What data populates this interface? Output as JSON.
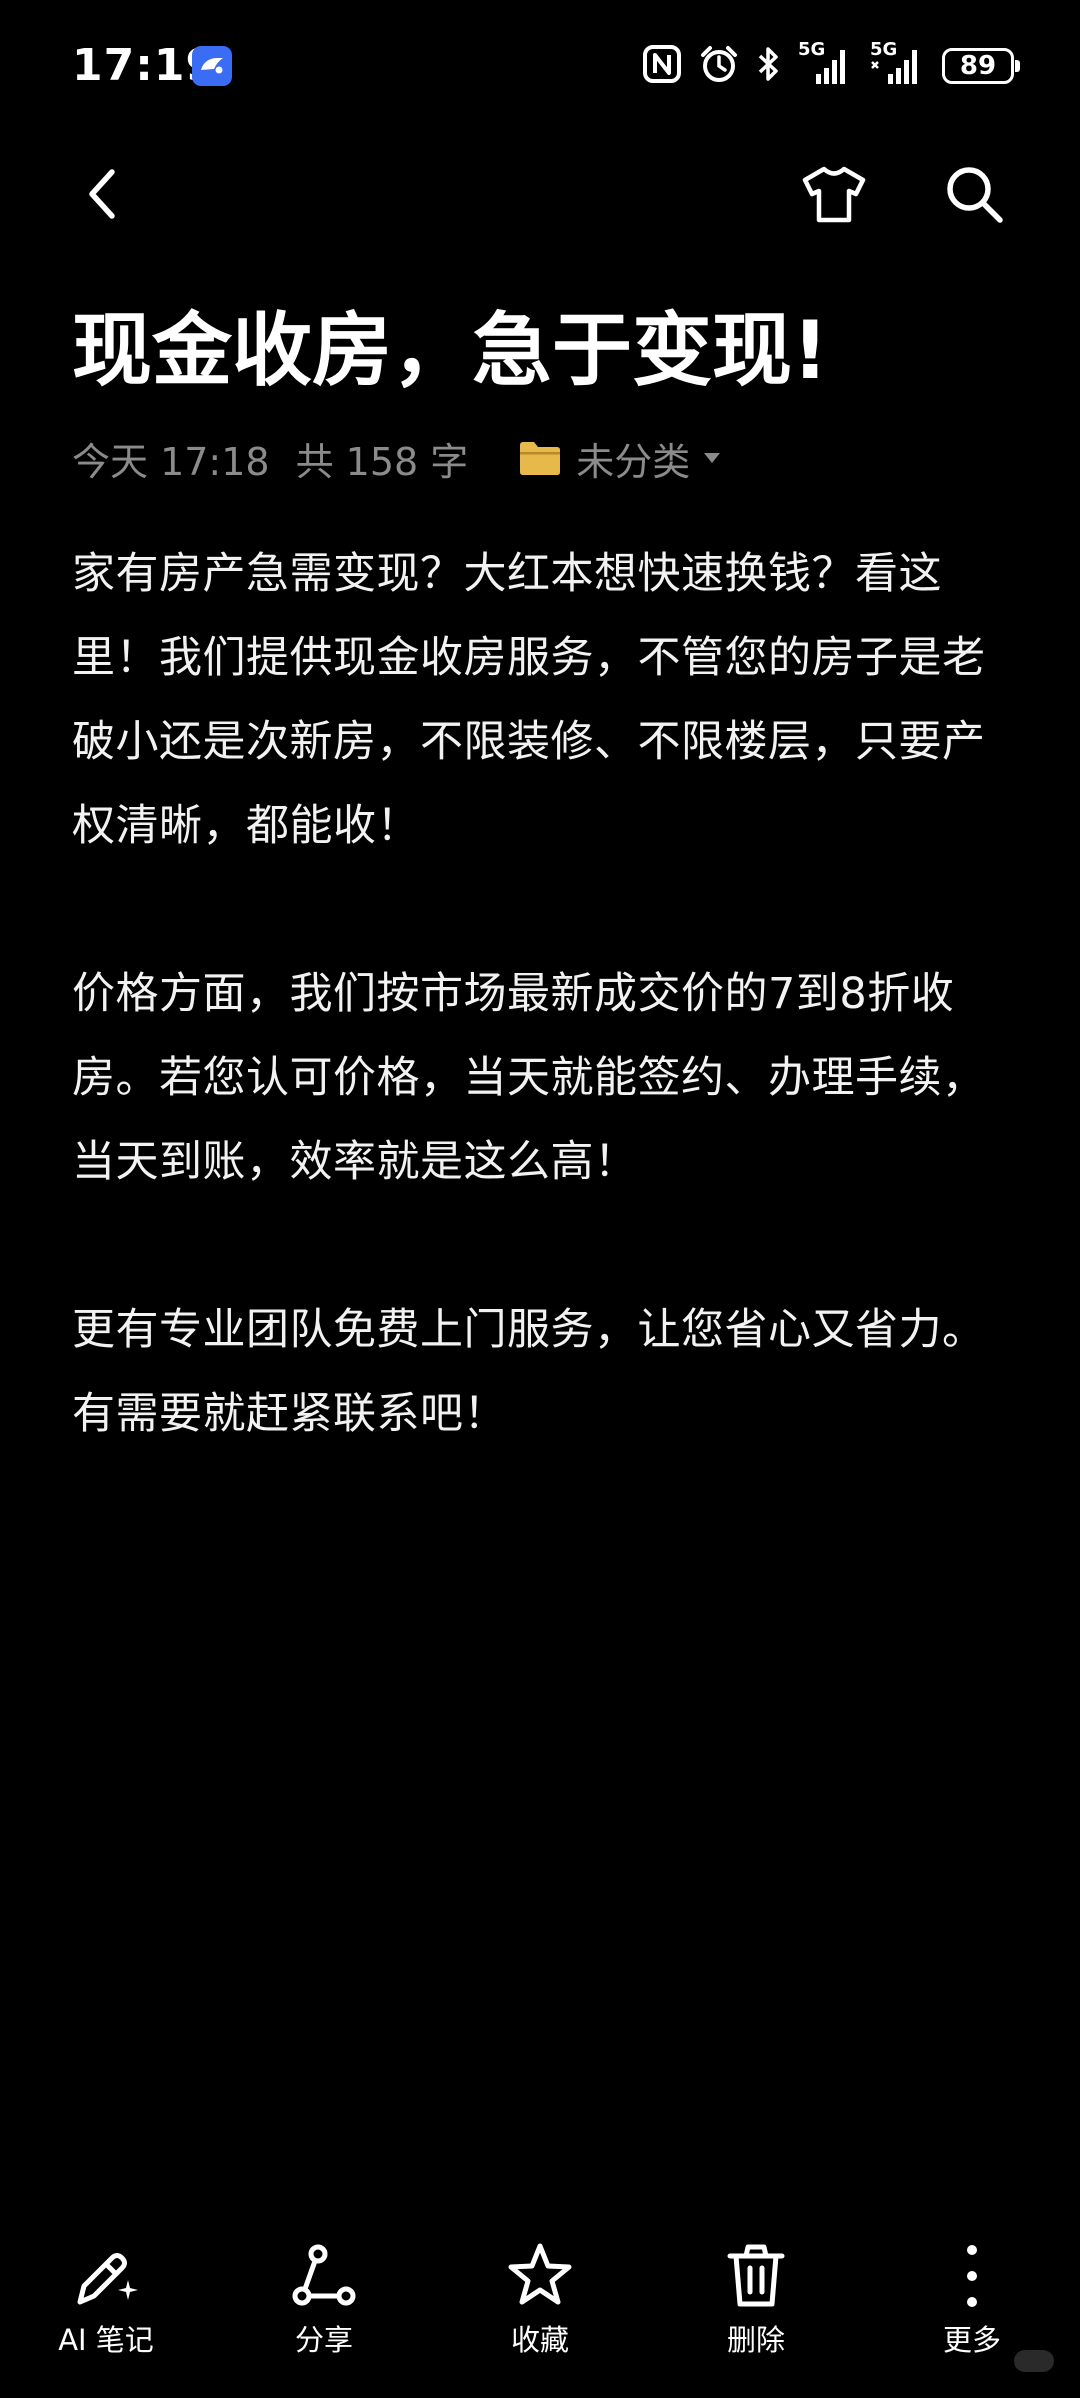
{
  "status_bar": {
    "time": "17:19",
    "network_gen_1": "5G",
    "network_gen_2": "5G",
    "battery": "89",
    "icons": [
      "app-notification-icon",
      "nfc-icon",
      "alarm-icon",
      "bluetooth-icon",
      "signal-icon",
      "battery-icon"
    ]
  },
  "toolbar": {
    "icons": [
      "back-icon",
      "tshirt-icon",
      "search-icon"
    ]
  },
  "note": {
    "title": "现金收房，急于变现!",
    "date": "今天 17:18",
    "word_count": "共 158 字",
    "folder": "未分类",
    "paragraphs": [
      "家有房产急需变现？大红本想快速换钱？看这里！我们提供现金收房服务，不管您的房子是老破小还是次新房，不限装修、不限楼层，只要产权清晰，都能收！",
      "价格方面，我们按市场最新成交价的7到8折收房。若您认可价格，当天就能签约、办理手续，当天到账，效率就是这么高！",
      "更有专业团队免费上门服务，让您省心又省力。有需要就赶紧联系吧！"
    ]
  },
  "bottom_bar": {
    "ai_note": "AI 笔记",
    "share": "分享",
    "favorite": "收藏",
    "delete": "删除",
    "more": "更多"
  },
  "colors": {
    "background": "#000000",
    "text": "#ffffff",
    "meta_text": "#8b8b8b",
    "folder_icon": "#e7b84a",
    "app_badge": "#3a6cf4"
  }
}
